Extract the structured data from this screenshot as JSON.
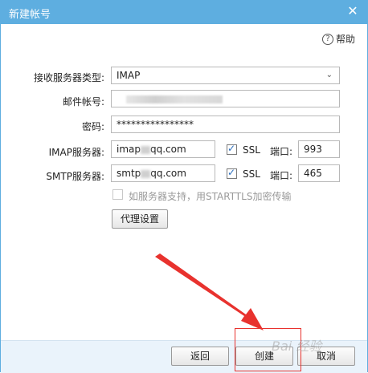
{
  "window": {
    "title": "新建帐号"
  },
  "help": {
    "label": "帮助"
  },
  "form": {
    "server_type": {
      "label": "接收服务器类型:",
      "value": "IMAP"
    },
    "email": {
      "label": "邮件帐号:",
      "value": ""
    },
    "password": {
      "label": "密码:",
      "value": "****************"
    },
    "imap": {
      "label": "IMAP服务器:",
      "server_prefix": "imap",
      "server_suffix": "qq.com",
      "ssl_label": "SSL",
      "ssl_checked": true,
      "port_label": "端口:",
      "port": "993"
    },
    "smtp": {
      "label": "SMTP服务器:",
      "server_prefix": "smtp",
      "server_suffix": "qq.com",
      "ssl_label": "SSL",
      "ssl_checked": true,
      "port_label": "端口:",
      "port": "465"
    },
    "starttls": {
      "label": "如服务器支持，用STARTTLS加密传输",
      "checked": false,
      "disabled": true
    },
    "proxy_button": "代理设置"
  },
  "footer": {
    "back_button": "返回",
    "create_button": "创建",
    "cancel_button": "取消"
  },
  "colors": {
    "titlebar": "#5eaee0",
    "annotation_red": "#e8322e",
    "checkbox_blue": "#2a6ebf"
  }
}
